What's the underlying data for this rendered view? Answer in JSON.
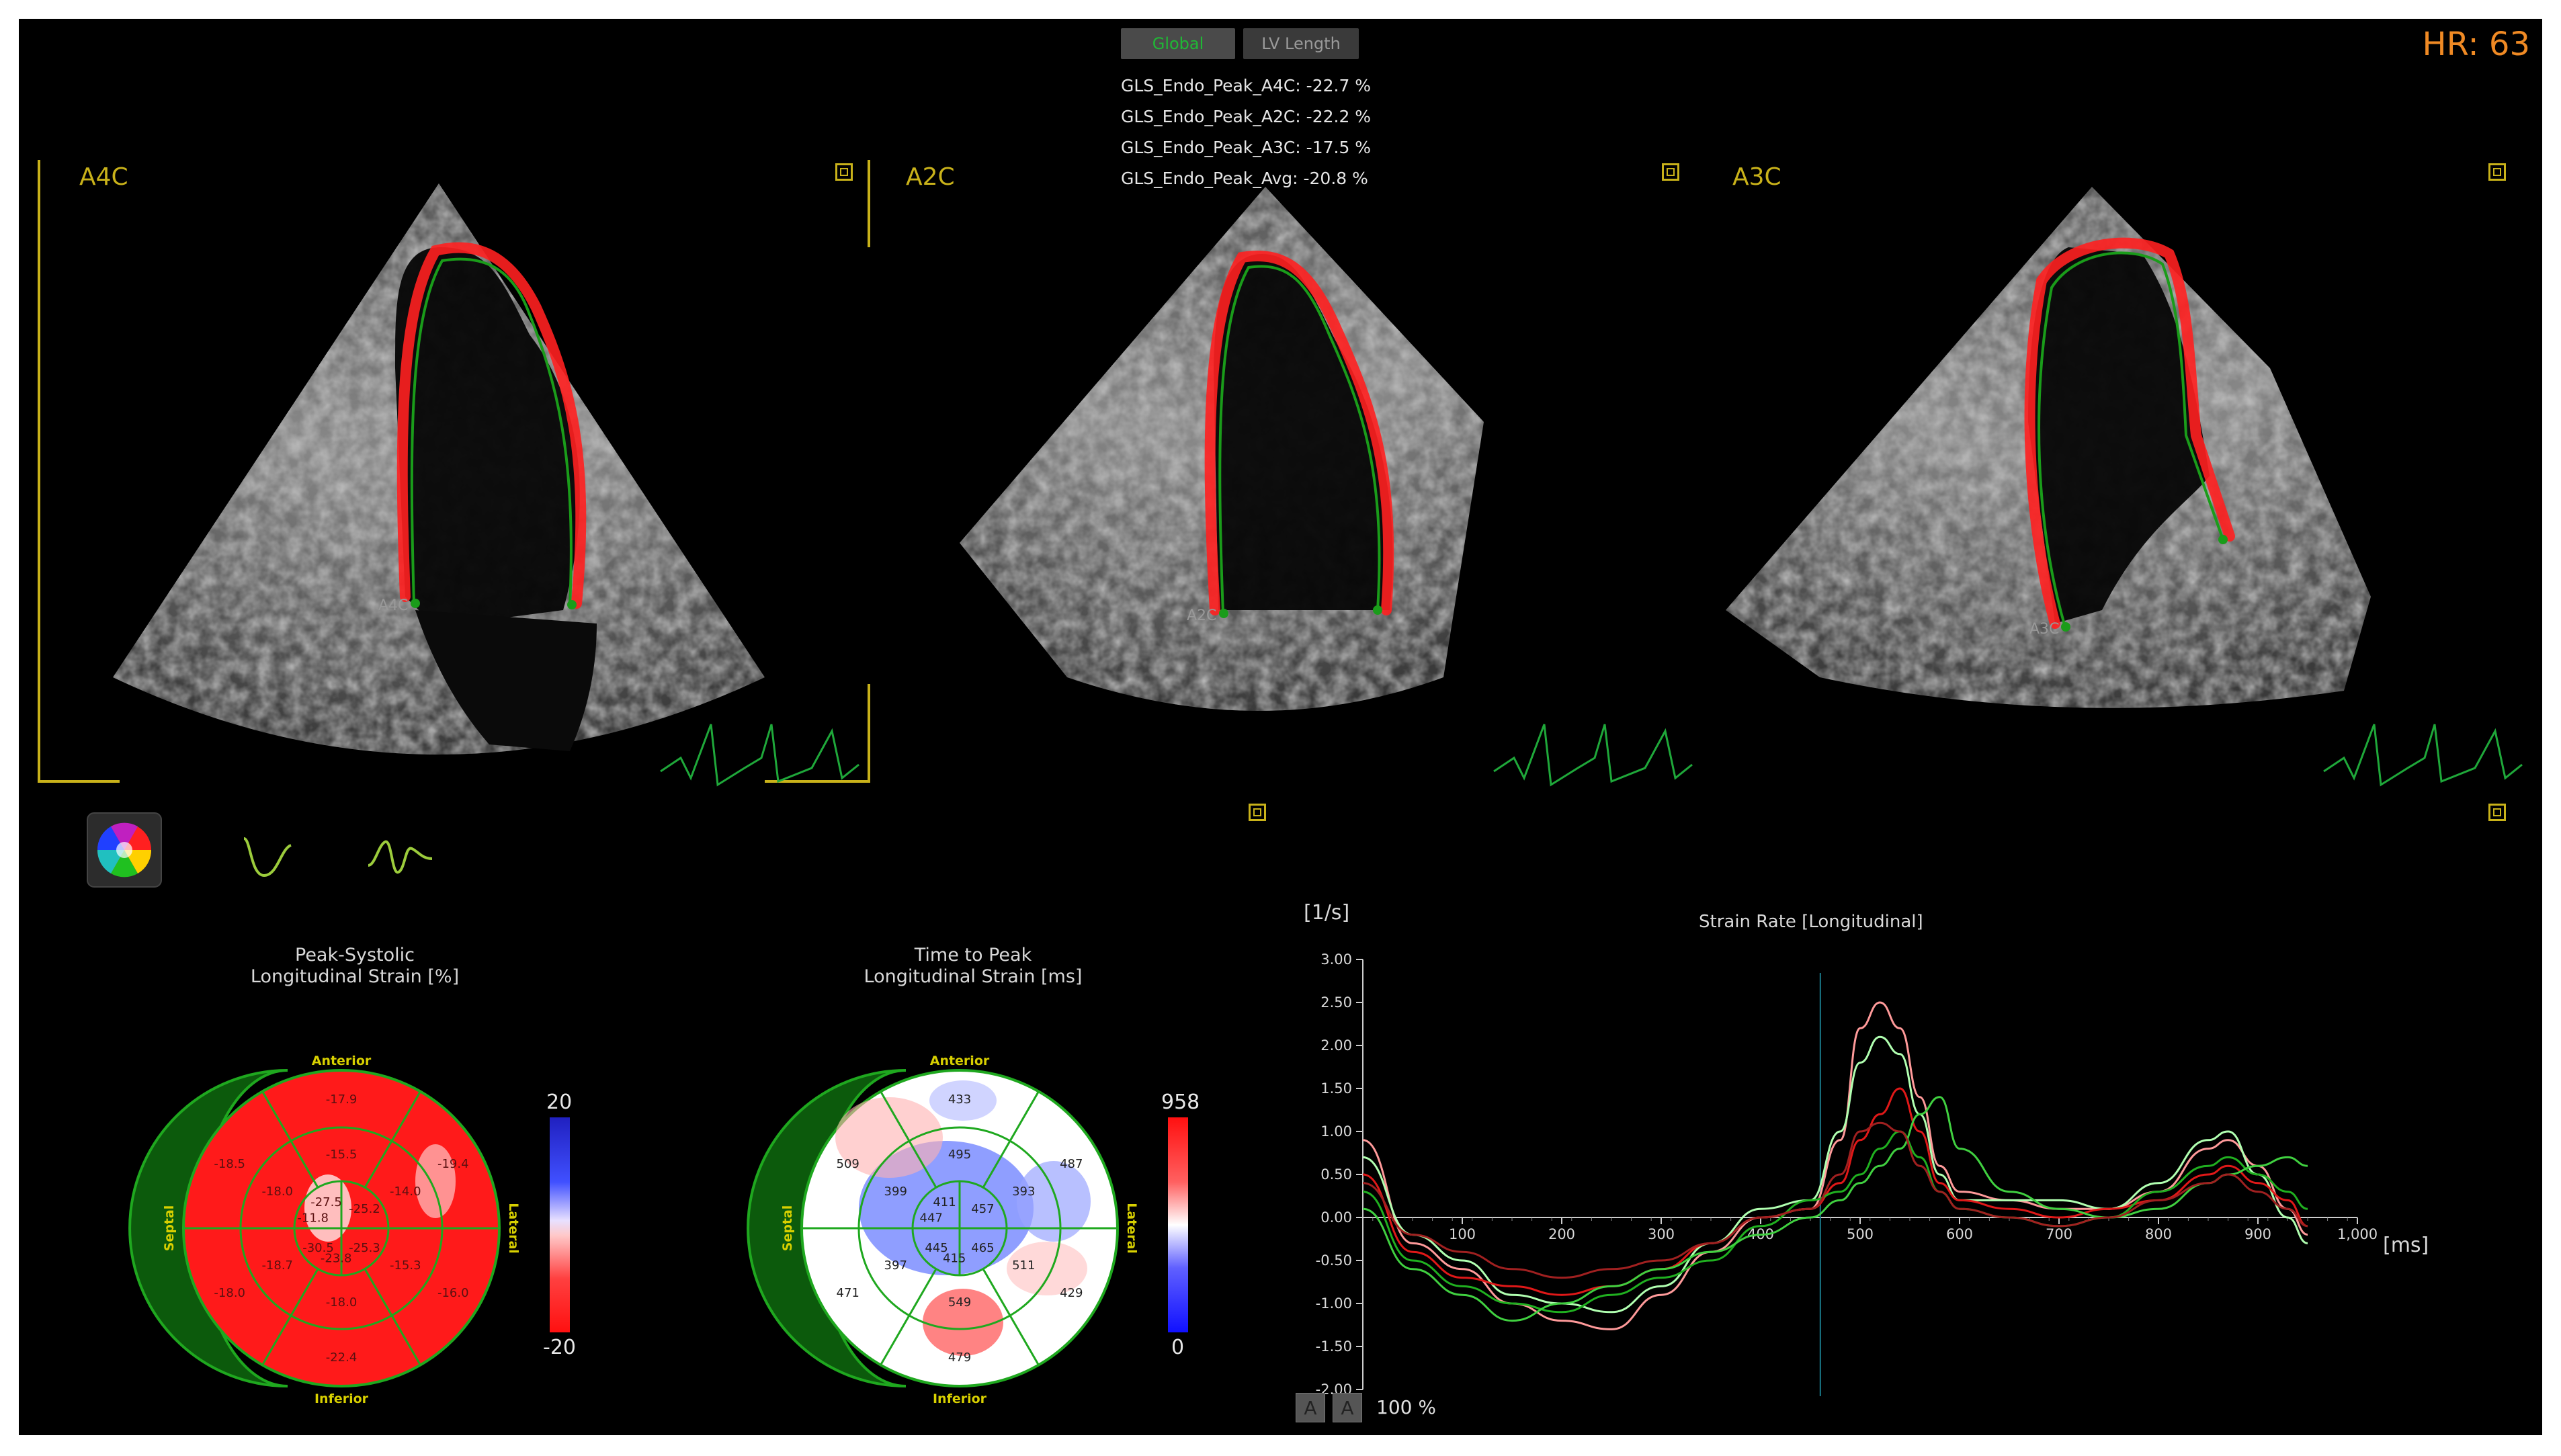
{
  "tabs": {
    "global": "Global",
    "lv_length": "LV Length"
  },
  "gls": [
    "GLS_Endo_Peak_A4C: -22.7 %",
    "GLS_Endo_Peak_A2C: -22.2 %",
    "GLS_Endo_Peak_A3C: -17.5 %",
    "GLS_Endo_Peak_Avg: -20.8 %"
  ],
  "heart_rate": "HR: 63",
  "views": [
    {
      "label": "A4C",
      "marker": "A4C"
    },
    {
      "label": "A2C",
      "marker": "A2C"
    },
    {
      "label": "A3C",
      "marker": "A3C"
    }
  ],
  "icons": [
    "color-wheel-icon",
    "strain-curve-icon",
    "strain-rate-curve-icon",
    "view-toggle-icon"
  ],
  "colors": {
    "accent_yellow": "#c9b21a",
    "hr_orange": "#f08a24",
    "tab_active_green": "#1fb835",
    "trace_red": "#ff2020",
    "trace_green": "#1a9c1a"
  },
  "bullseye_strain": {
    "title_line1": "Peak-Systolic",
    "title_line2": "Longitudinal Strain [%]",
    "walls": {
      "anterior": "Anterior",
      "inferior": "Inferior",
      "septal": "Septal",
      "lateral": "Lateral"
    },
    "values": {
      "basal": [
        "-17.9",
        "-19.4",
        "-16.0",
        "-22.4",
        "-18.0",
        "-18.5"
      ],
      "mid": [
        "-15.5",
        "-14.0",
        "-15.3",
        "-18.0",
        "-18.7",
        "-18.0"
      ],
      "apical": [
        "-27.5",
        "-25.2",
        "-25.3",
        "-23.8",
        "-30.5",
        "-11.8"
      ]
    },
    "scale_max": "20",
    "scale_min": "-20"
  },
  "bullseye_time": {
    "title_line1": "Time to Peak",
    "title_line2": "Longitudinal Strain [ms]",
    "walls": {
      "anterior": "Anterior",
      "inferior": "Inferior",
      "septal": "Septal",
      "lateral": "Lateral"
    },
    "values": {
      "basal": [
        "433",
        "487",
        "429",
        "479",
        "471",
        "509"
      ],
      "mid": [
        "495",
        "393",
        "511",
        "549",
        "397",
        "399"
      ],
      "apical": [
        "411",
        "457",
        "465",
        "415",
        "445",
        "447"
      ]
    },
    "scale_max": "958",
    "scale_min": "0"
  },
  "chart_data": {
    "type": "line",
    "title": "Strain Rate [Longitudinal]",
    "ylabel": "[1/s]",
    "xlabel": "[ms]",
    "xlim": [
      0,
      1000
    ],
    "ylim": [
      -2.0,
      3.0
    ],
    "x_ticks": [
      "100",
      "200",
      "300",
      "400",
      "500",
      "600",
      "700",
      "800",
      "900",
      "1,000"
    ],
    "y_ticks": [
      "3.00",
      "2.50",
      "2.00",
      "1.50",
      "1.00",
      "0.50",
      "0.00",
      "-0.50",
      "-1.00",
      "-1.50",
      "-2.00"
    ],
    "marker_x": 460,
    "x": [
      0,
      50,
      100,
      150,
      200,
      250,
      300,
      350,
      400,
      450,
      480,
      500,
      520,
      540,
      560,
      580,
      600,
      650,
      700,
      750,
      800,
      850,
      870,
      900,
      930,
      950
    ],
    "series": [
      {
        "color": "#ff9a9a",
        "values": [
          0.9,
          -0.3,
          -0.6,
          -1.0,
          -1.2,
          -1.3,
          -0.9,
          -0.4,
          0.0,
          0.1,
          0.9,
          2.2,
          2.5,
          2.2,
          1.4,
          0.6,
          0.3,
          0.2,
          0.1,
          0.1,
          0.3,
          0.8,
          0.9,
          0.6,
          0.1,
          -0.2
        ]
      },
      {
        "color": "#b0ffb0",
        "values": [
          0.7,
          -0.2,
          -0.5,
          -0.9,
          -1.0,
          -1.1,
          -0.8,
          -0.3,
          0.1,
          0.2,
          1.0,
          1.8,
          2.1,
          1.9,
          1.2,
          0.5,
          0.2,
          0.2,
          0.2,
          0.1,
          0.4,
          0.9,
          1.0,
          0.5,
          0.0,
          -0.3
        ]
      },
      {
        "color": "#e01818",
        "values": [
          0.5,
          -0.4,
          -0.7,
          -0.8,
          -0.9,
          -0.8,
          -0.6,
          -0.3,
          0.0,
          0.1,
          0.4,
          0.9,
          1.2,
          1.5,
          1.0,
          0.4,
          0.2,
          0.1,
          0.0,
          0.1,
          0.2,
          0.5,
          0.6,
          0.4,
          0.2,
          -0.1
        ]
      },
      {
        "color": "#20b020",
        "values": [
          0.3,
          -0.5,
          -0.8,
          -1.0,
          -1.1,
          -0.9,
          -0.7,
          -0.5,
          -0.1,
          0.2,
          0.3,
          0.5,
          0.8,
          1.0,
          0.7,
          0.3,
          0.1,
          0.0,
          -0.1,
          0.0,
          0.3,
          0.6,
          0.7,
          0.5,
          0.3,
          0.1
        ]
      },
      {
        "color": "#40d040",
        "values": [
          0.1,
          -0.6,
          -0.9,
          -1.2,
          -1.0,
          -0.8,
          -0.6,
          -0.4,
          -0.2,
          0.0,
          0.2,
          0.4,
          0.6,
          0.8,
          1.2,
          1.4,
          0.8,
          0.3,
          0.1,
          0.0,
          0.1,
          0.4,
          0.5,
          0.6,
          0.7,
          0.6
        ]
      },
      {
        "color": "#a02020",
        "values": [
          0.4,
          -0.2,
          -0.4,
          -0.6,
          -0.7,
          -0.6,
          -0.5,
          -0.3,
          0.0,
          0.1,
          0.5,
          1.0,
          1.1,
          1.0,
          0.6,
          0.3,
          0.1,
          0.0,
          -0.1,
          0.0,
          0.2,
          0.4,
          0.5,
          0.3,
          0.1,
          -0.1
        ]
      }
    ]
  },
  "bottom_controls": {
    "zoom": "100 %",
    "btn_a": "A",
    "btn_b": "A"
  }
}
